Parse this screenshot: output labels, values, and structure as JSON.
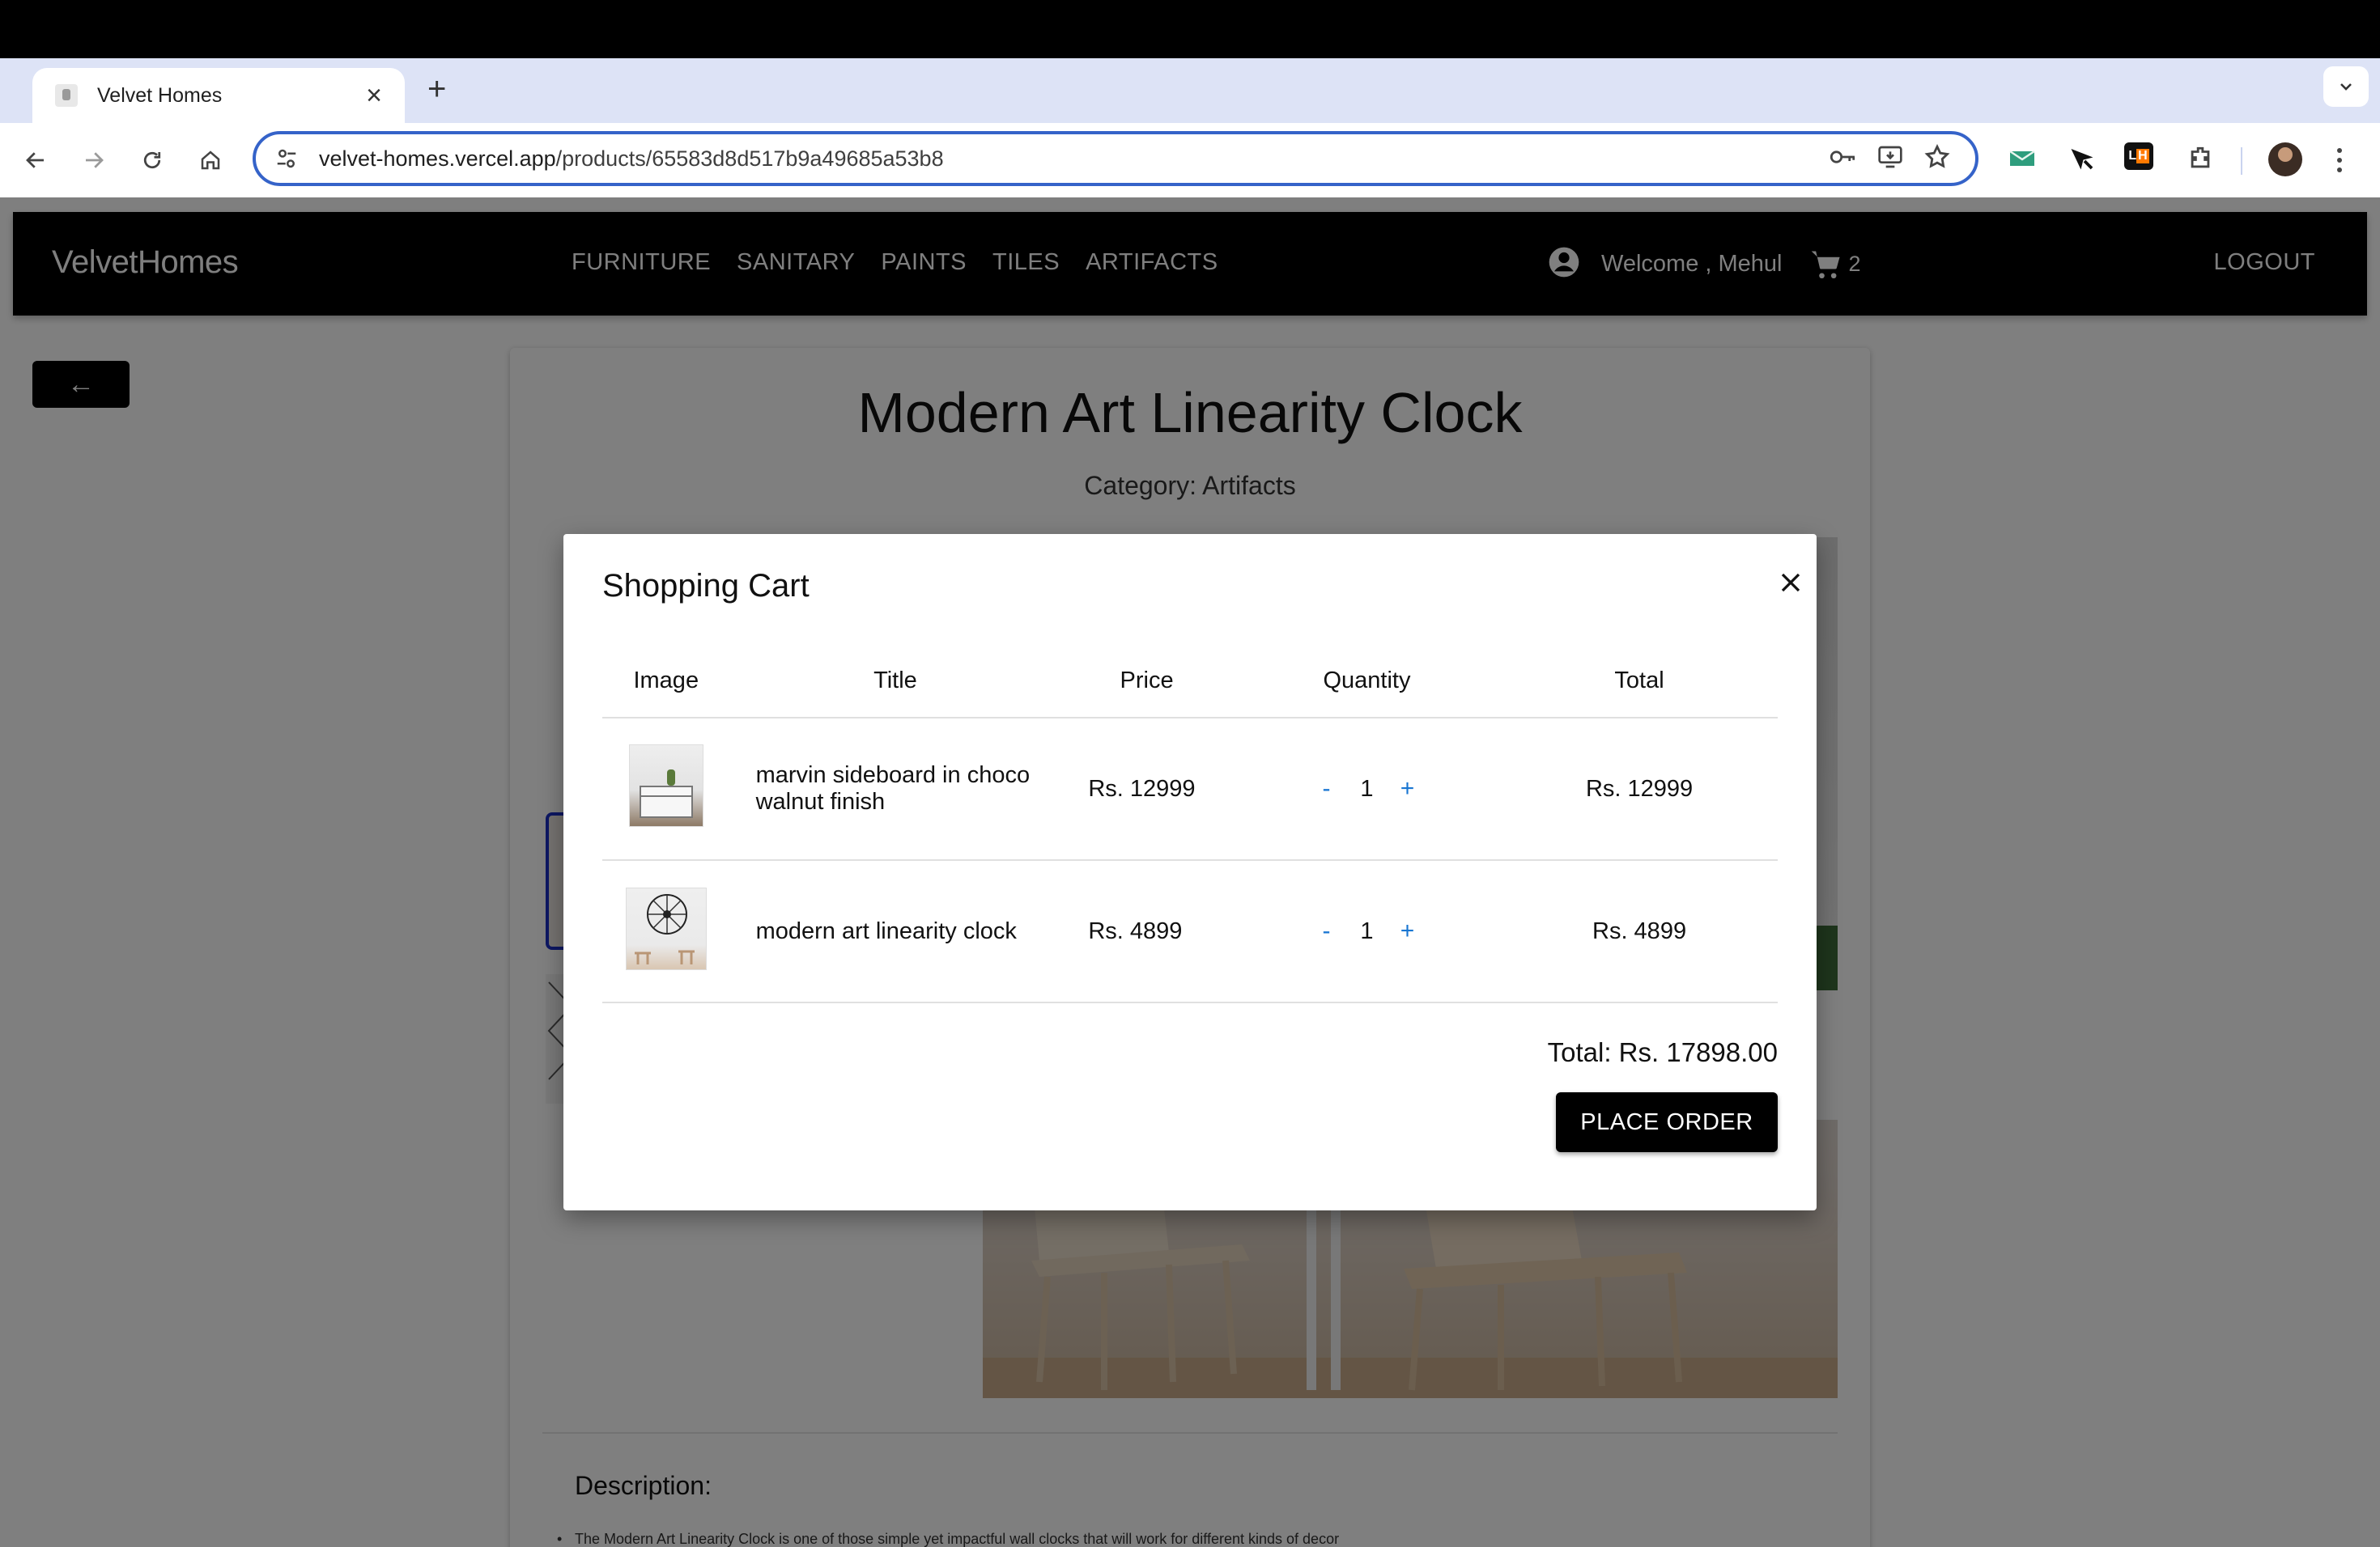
{
  "browser": {
    "tab_title": "Velvet Homes",
    "new_tab_label": "+",
    "url_host": "velvet-homes.vercel.app",
    "url_path": "/products/65583d8d517b9a49685a53b8"
  },
  "navbar": {
    "brand": "VelvetHomes",
    "links": [
      "FURNITURE",
      "SANITARY",
      "PAINTS",
      "TILES",
      "ARTIFACTS"
    ],
    "welcome": "Welcome , Mehul",
    "cart_count": "2",
    "logout": "LOGOUT"
  },
  "page": {
    "back_label": "←",
    "product_title": "Modern Art Linearity Clock",
    "category": "Category: Artifacts",
    "description_heading": "Description:",
    "description_text": "The Modern Art Linearity Clock is one of those simple yet impactful wall clocks that will work for different kinds of decor"
  },
  "cart_modal": {
    "title": "Shopping Cart",
    "columns": [
      "Image",
      "Title",
      "Price",
      "Quantity",
      "Total"
    ],
    "items": [
      {
        "title": "marvin sideboard in choco walnut finish",
        "price": "Rs. 12999",
        "quantity": "1",
        "total": "Rs. 12999",
        "decrement": "-",
        "increment": "+"
      },
      {
        "title": "modern art linearity clock",
        "price": "Rs. 4899",
        "quantity": "1",
        "total": "Rs. 4899",
        "decrement": "-",
        "increment": "+"
      }
    ],
    "grand_total": "Total: Rs. 17898.00",
    "place_order": "PLACE ORDER"
  },
  "colors": {
    "navbar_bg": "#000000",
    "accent_blue": "#1976d2",
    "omnibox_border": "#3563c9",
    "tabstrip_bg": "#dde3f6"
  },
  "icons": [
    "back-arrow-icon",
    "forward-arrow-icon",
    "reload-icon",
    "home-icon",
    "tune-icon",
    "key-icon",
    "install-icon",
    "star-icon",
    "extensions-icon",
    "account-circle-icon",
    "shopping-cart-icon",
    "close-icon"
  ]
}
